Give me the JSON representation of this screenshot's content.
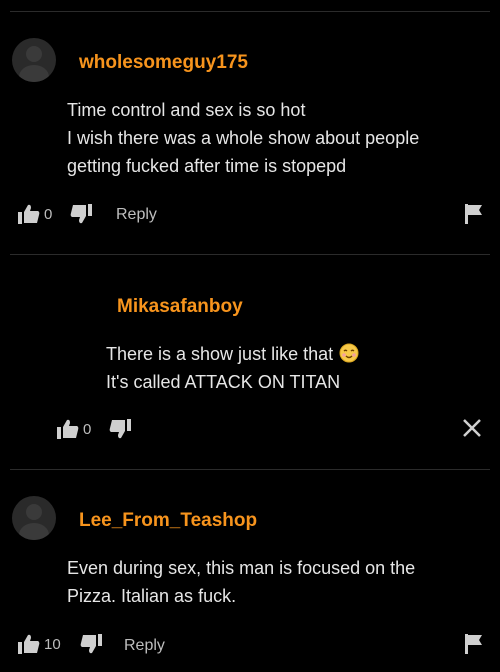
{
  "comments": [
    {
      "username": "wholesomeguy175",
      "lines": [
        "Time control and sex is so hot",
        "I wish there was a whole show about people",
        "getting fucked after time is stopepd"
      ],
      "likes": "0",
      "reply_label": "Reply",
      "has_flag": true
    },
    {
      "username": "Mikasafanboy",
      "lines": [
        "There is a show just like that",
        "It's called ATTACK ON TITAN"
      ],
      "likes": "0",
      "has_close": true,
      "emoji": "smiling-blush-emoji"
    },
    {
      "username": "Lee_From_Teashop",
      "lines": [
        "Even during sex, this man is focused on the",
        "Pizza. Italian as fuck."
      ],
      "likes": "10",
      "reply_label": "Reply",
      "has_flag": true
    }
  ],
  "icons": {
    "like": "thumbs-up-icon",
    "dislike": "thumbs-down-icon",
    "flag": "flag-icon",
    "close": "close-icon"
  },
  "colors": {
    "username": "#f7941d",
    "text": "#e6e6e6",
    "muted": "#bdbdbd",
    "background": "#000000"
  }
}
